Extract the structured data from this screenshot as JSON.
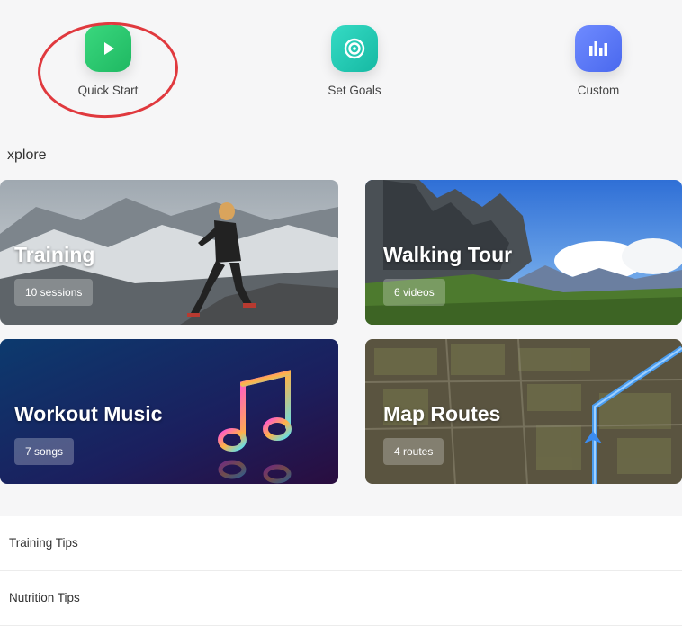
{
  "quick_actions": [
    {
      "label": "Quick Start",
      "icon": "play-icon",
      "color": "#2ecc71"
    },
    {
      "label": "Set Goals",
      "icon": "target-icon",
      "color": "#1fc8b2"
    },
    {
      "label": "Custom",
      "icon": "bars-icon",
      "color": "#5b7cf5"
    }
  ],
  "annotation": {
    "color": "#e0393e"
  },
  "explore": {
    "title": "xplore",
    "cards": [
      {
        "title": "Training",
        "badge": "10 sessions"
      },
      {
        "title": "Walking Tour",
        "badge": "6 videos"
      },
      {
        "title": "Workout Music",
        "badge": "7 songs"
      },
      {
        "title": "Map Routes",
        "badge": "4 routes"
      }
    ]
  },
  "tips": [
    {
      "label": "Training Tips"
    },
    {
      "label": "Nutrition Tips"
    }
  ]
}
